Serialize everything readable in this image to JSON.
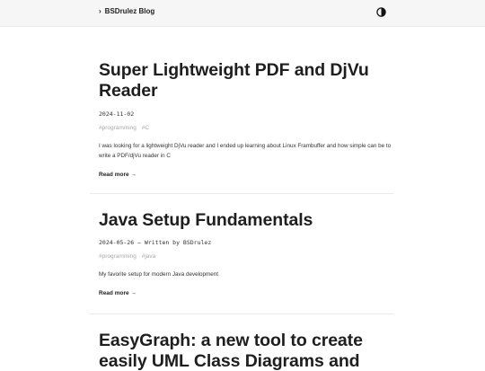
{
  "header": {
    "brand_chevron": "›",
    "brand": "BSDrulez Blog",
    "theme_icon": "contrast-icon"
  },
  "posts": [
    {
      "title": "Super Lightweight PDF and DjVu Reader",
      "date": "2024-11-02",
      "author_line": "",
      "tags": [
        "#programming",
        "#C"
      ],
      "summary": "I was looking for a lightweight DjVu reader and I ended up learning about Linux Frambuffer and how simple can be to write a PDF/djVu reader in C",
      "read_more": "Read more →"
    },
    {
      "title": "Java Setup Fundamentals",
      "date": "2024-05-26",
      "author_line": " — Written by BSDrulez",
      "tags": [
        "#programming",
        "#java"
      ],
      "summary": "My favorite setup for modern Java development",
      "read_more": "Read more →"
    },
    {
      "title": "EasyGraph: a new tool to create easily UML Class Diagrams and",
      "date": "",
      "author_line": "",
      "tags": [],
      "summary": "",
      "read_more": ""
    }
  ]
}
